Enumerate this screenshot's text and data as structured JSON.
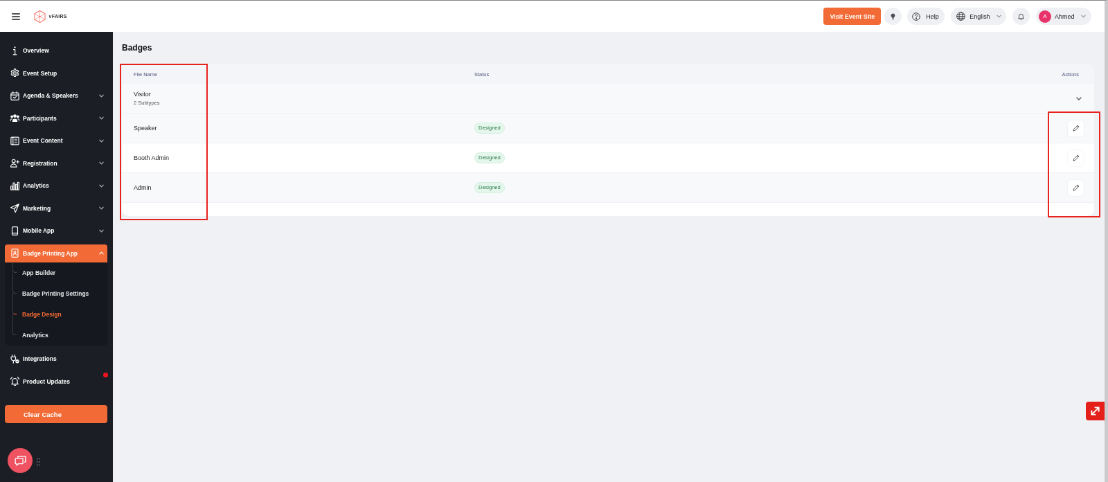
{
  "header": {
    "logo_text": "vFAIRS",
    "visit_button": "Visit Event Site",
    "help_button": "Help",
    "language": "English",
    "user": {
      "initial": "A",
      "name": "Ahmed"
    }
  },
  "sidebar": {
    "items": [
      {
        "label": "Overview",
        "kind": "link",
        "selected": false,
        "unread": false
      },
      {
        "label": "Event Setup",
        "kind": "link",
        "selected": false,
        "unread": false
      },
      {
        "label": "Agenda & Speakers",
        "kind": "group",
        "expanded": false,
        "selected": false,
        "unread": false
      },
      {
        "label": "Participants",
        "kind": "group",
        "expanded": false,
        "selected": false,
        "unread": false
      },
      {
        "label": "Event Content",
        "kind": "group",
        "expanded": false,
        "selected": false,
        "unread": false
      },
      {
        "label": "Registration",
        "kind": "group",
        "expanded": false,
        "selected": false,
        "unread": false
      },
      {
        "label": "Analytics",
        "kind": "group",
        "expanded": false,
        "selected": false,
        "unread": false
      },
      {
        "label": "Marketing",
        "kind": "group",
        "expanded": false,
        "selected": false,
        "unread": false
      },
      {
        "label": "Mobile App",
        "kind": "group",
        "expanded": false,
        "selected": false,
        "unread": false
      },
      {
        "label": "Badge Printing App",
        "kind": "group",
        "expanded": true,
        "selected": true,
        "unread": false,
        "children": [
          {
            "label": "App Builder",
            "selected": false
          },
          {
            "label": "Badge Printing Settings",
            "selected": false
          },
          {
            "label": "Badge Design",
            "selected": true
          },
          {
            "label": "Analytics",
            "selected": false
          }
        ]
      },
      {
        "label": "Integrations",
        "kind": "link",
        "selected": false,
        "unread": false
      },
      {
        "label": "Product Updates",
        "kind": "link",
        "selected": false,
        "unread": true
      }
    ],
    "clear_cache_button": "Clear Cache"
  },
  "page": {
    "title": "Badges"
  },
  "table": {
    "columns": [
      {
        "label": "File Name",
        "kind": "name",
        "highlighted": true
      },
      {
        "label": "Status",
        "kind": "status",
        "highlighted": false
      },
      {
        "label": "Actions",
        "kind": "actions",
        "highlighted": true
      }
    ],
    "rows": [
      {
        "kind": "group",
        "name": "Visitor",
        "subtitle": "2 Subtypes",
        "expanded": false
      },
      {
        "kind": "badge",
        "name": "Speaker",
        "status": "Designed"
      },
      {
        "kind": "badge",
        "name": "Booth Admin",
        "status": "Designed"
      },
      {
        "kind": "badge",
        "name": "Admin",
        "status": "Designed"
      }
    ]
  }
}
